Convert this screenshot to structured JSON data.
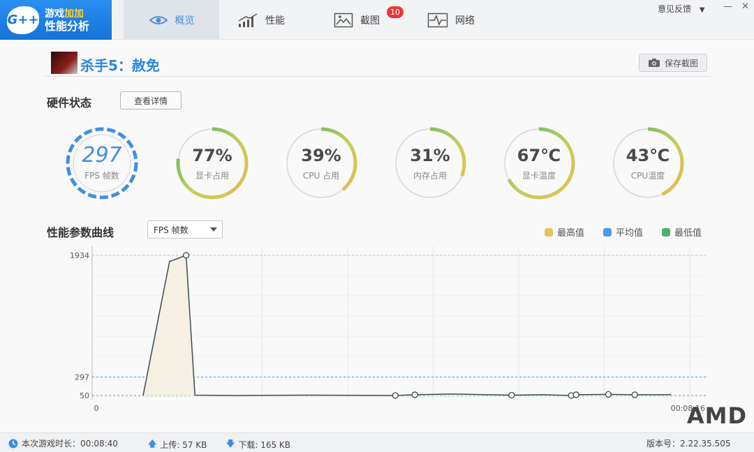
{
  "app": {
    "logo_mark": "G++",
    "logo_line1_a": "游戏",
    "logo_line1_b": "加加",
    "logo_line2": "性能分析",
    "feedback": "意见反馈",
    "minimize": "—",
    "close": "✕"
  },
  "tabs": [
    {
      "label": "概览",
      "icon": "eye-icon",
      "active": true
    },
    {
      "label": "性能",
      "icon": "performance-chart-icon",
      "active": false
    },
    {
      "label": "截图",
      "icon": "picture-icon",
      "active": false,
      "badge": "10"
    },
    {
      "label": "网络",
      "icon": "network-pulse-icon",
      "active": false
    }
  ],
  "game": {
    "title": "杀手5：赦免",
    "save_screenshot": "保存截图"
  },
  "hardware": {
    "title": "硬件状态",
    "detail_button": "查看详情",
    "gauges": [
      {
        "value": "297",
        "label": "FPS 帧数",
        "percent": 100
      },
      {
        "value": "77%",
        "label": "显卡占用",
        "percent": 77
      },
      {
        "value": "39%",
        "label": "CPU 占用",
        "percent": 39
      },
      {
        "value": "31%",
        "label": "内存占用",
        "percent": 31
      },
      {
        "value": "67℃",
        "label": "显卡温度",
        "percent": 67
      },
      {
        "value": "43℃",
        "label": "CPU温度",
        "percent": 43
      }
    ]
  },
  "curve": {
    "title": "性能参数曲线",
    "selected_metric": "FPS 帧数",
    "legend": [
      {
        "label": "最高值",
        "color": "#e8c068"
      },
      {
        "label": "平均值",
        "color": "#4a9be8"
      },
      {
        "label": "最低值",
        "color": "#4db06a"
      }
    ]
  },
  "chart_data": {
    "type": "area",
    "y_labels": [
      "1934",
      "297",
      "50"
    ],
    "x_labels": [
      "0",
      "00:08:16"
    ],
    "max": 1934,
    "avg": 297,
    "min": 50,
    "ylim": [
      0,
      1934
    ],
    "xlim": [
      0,
      496
    ],
    "grid": true,
    "x": [
      0,
      27,
      44,
      53,
      95,
      170,
      258,
      278,
      316,
      377,
      409,
      438,
      443,
      476,
      503,
      512,
      540
    ],
    "y": [
      50,
      1850,
      1934,
      55,
      50,
      55,
      50,
      60,
      70,
      55,
      60,
      50,
      60,
      65,
      60,
      60,
      60
    ],
    "markers": [
      2,
      6,
      7,
      9,
      11,
      12,
      13,
      14
    ]
  },
  "status": {
    "session_label": "本次游戏时长：",
    "session_value": "00:08:40",
    "upload_label": "上传: ",
    "upload_value": "57 KB",
    "download_label": "下载: ",
    "download_value": "165 KB",
    "version_label": "版本号：",
    "version_value": "2.22.35.505",
    "amd_logo": "AMD"
  }
}
